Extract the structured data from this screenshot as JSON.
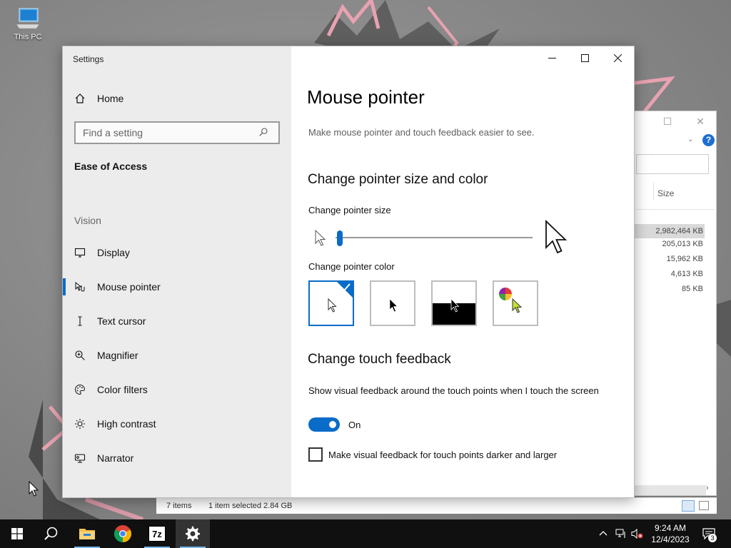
{
  "desktop": {
    "icon_label": "This PC"
  },
  "explorer": {
    "column_size": "Size",
    "sizes": [
      "2,982,464 KB",
      "205,013 KB",
      "15,962 KB",
      "4,613 KB",
      "85 KB"
    ],
    "status_items": "7 items",
    "status_selected": "1 item selected  2.84 GB",
    "help_glyph": "?"
  },
  "settings": {
    "window_title": "Settings",
    "home_label": "Home",
    "search_placeholder": "Find a setting",
    "section_title": "Ease of Access",
    "group_vision": "Vision",
    "nav": [
      {
        "label": "Display"
      },
      {
        "label": "Mouse pointer"
      },
      {
        "label": "Text cursor"
      },
      {
        "label": "Magnifier"
      },
      {
        "label": "Color filters"
      },
      {
        "label": "High contrast"
      },
      {
        "label": "Narrator"
      }
    ],
    "page_title": "Mouse pointer",
    "description": "Make mouse pointer and touch feedback easier to see.",
    "pointer_heading": "Change pointer size and color",
    "pointer_size_label": "Change pointer size",
    "pointer_size_value": 0.02,
    "pointer_color_label": "Change pointer color",
    "color_options": [
      "white",
      "black",
      "inverted",
      "custom"
    ],
    "selected_color": "white",
    "touch_heading": "Change touch feedback",
    "touch_desc": "Show visual feedback around the touch points when I touch the screen",
    "toggle_state": "On",
    "checkbox_label": "Make visual feedback for touch points darker and larger",
    "accent_color": "#0a6cc8"
  },
  "taskbar": {
    "time": "9:24 AM",
    "date": "12/4/2023",
    "notification_count": "3",
    "seven_zip_label": "7z"
  }
}
